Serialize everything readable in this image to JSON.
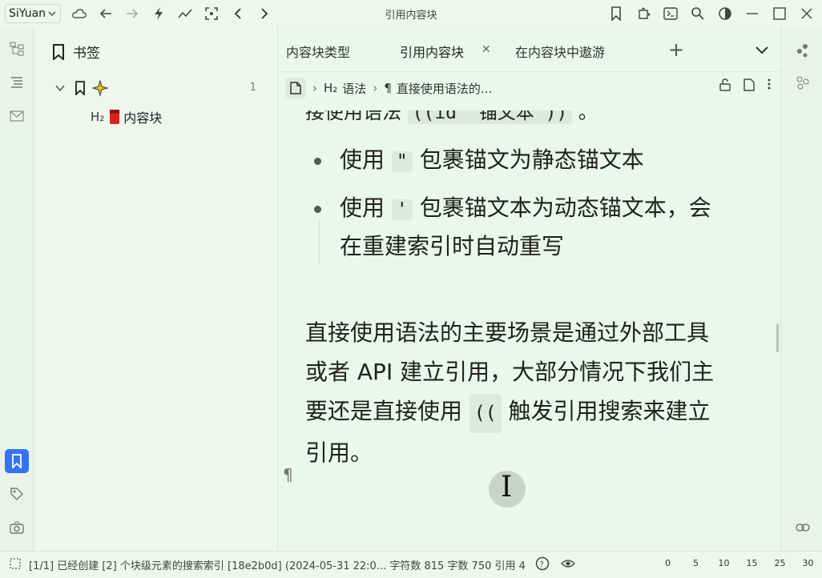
{
  "app": {
    "brand": "SiYuan",
    "window_title": "引用内容块"
  },
  "panel": {
    "title": "书签",
    "tree": {
      "root_count": "1",
      "child_level": "H₂",
      "child_label": "内容块"
    }
  },
  "tabs": [
    {
      "label": "内容块类型"
    },
    {
      "label": "引用内容块"
    },
    {
      "label": "在内容块中遨游"
    }
  ],
  "breadcrumb": {
    "heading_level": "H₂",
    "heading": "语法",
    "paragraph_mark": "¶",
    "paragraph": "直接使用语法的..."
  },
  "content": {
    "cut_line_prefix": "接使用语法",
    "cut_line_code": "((id \"锚文本\"))",
    "cut_line_suffix": "。",
    "list": [
      {
        "prefix": "使用",
        "code": "\"",
        "suffix": "包裹锚文为静态锚文本"
      },
      {
        "prefix": "使用",
        "code": "'",
        "suffix": "包裹锚文本为动态锚文本，会",
        "line2": "在重建索引时自动重写"
      }
    ],
    "para_line1": "直接使用语法的主要场景是通过外部工具",
    "para_line2": "或者 API 建立引用，大部分情况下我们主",
    "para_line3_prefix": "要还是直接使用",
    "para_line3_code": "((",
    "para_line3_suffix": "触发引用搜索来建立",
    "para_line4": "引用。",
    "empty_pilcrow": "¶"
  },
  "status": {
    "text": "[1/1] 已经创建 [2] 个块级元素的搜索索引 [18e2b0d] (2024-05-31 22:0... 字符数 815  字数 750  引用 4",
    "zoom": [
      "0",
      "5",
      "10",
      "15",
      "25",
      "30"
    ]
  },
  "colors": {
    "accent": "#3573f0",
    "bg": "#eef6ee",
    "editor_bg": "#eaf7ec"
  }
}
